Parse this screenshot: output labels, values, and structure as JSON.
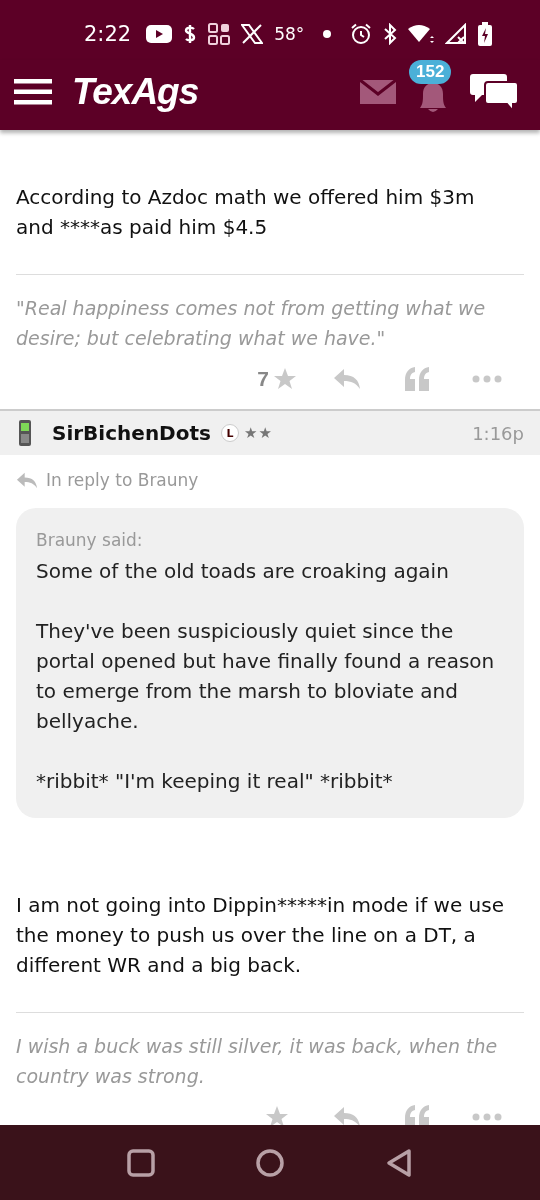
{
  "status_bar": {
    "time": "2:22",
    "temperature": "58°"
  },
  "header": {
    "logo": "TexAgs",
    "notification_count": "152"
  },
  "posts": [
    {
      "body": "According to Azdoc math we offered him $3m and ****as paid him $4.5",
      "signature": "\"Real happiness comes not from getting what we desire; but celebrating what we have.\"",
      "likes": "7"
    },
    {
      "author": "SirBichenDots",
      "badge": "L",
      "rank": "★★",
      "time": "1:16p",
      "reply_to": "In reply to Brauny",
      "quote": {
        "author": "Brauny said:",
        "paragraphs": [
          "Some of the old toads are croaking again",
          "They've been suspiciously quiet since the portal opened but have finally found a reason to emerge from the marsh to bloviate and bellyache.",
          "*ribbit* \"I'm keeping it real\" *ribbit*"
        ]
      },
      "body": "I am not going into Dippin*****in mode if we use the money to push us over the line on a DT, a different WR and a big back.",
      "signature": "I wish a buck was still silver, it was back, when the country was strong."
    }
  ]
}
